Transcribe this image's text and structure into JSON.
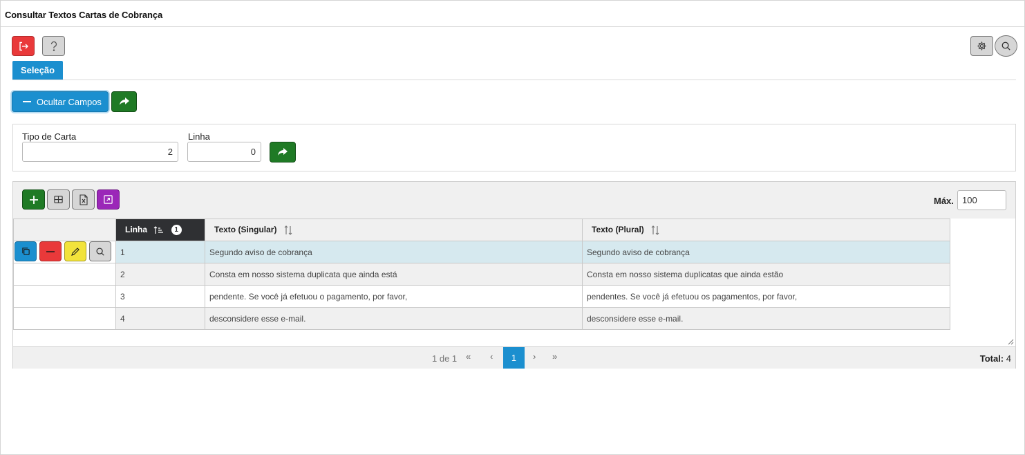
{
  "window": {
    "title": "Consultar Textos Cartas de Cobrança"
  },
  "tabs": [
    {
      "label": "Seleção",
      "active": true
    }
  ],
  "form": {
    "toggle_label": "Ocultar Campos",
    "fields": [
      {
        "label": "Tipo de Carta",
        "value": "2"
      },
      {
        "label": "Linha",
        "value": "0"
      }
    ]
  },
  "grid": {
    "max_label": "Máx.",
    "max_value": "100",
    "columns": [
      {
        "label": "Linha",
        "sort_badge": "1",
        "active": true
      },
      {
        "label": "Texto (Singular)"
      },
      {
        "label": "Texto (Plural)"
      }
    ],
    "rows": [
      {
        "linha": "1",
        "singular": "Segundo aviso de cobrança",
        "plural": "Segundo aviso de cobrança"
      },
      {
        "linha": "2",
        "singular": "Consta em nosso sistema duplicata que ainda está",
        "plural": "Consta em nosso sistema duplicatas que ainda estão"
      },
      {
        "linha": "3",
        "singular": "pendente. Se você já efetuou o pagamento, por favor,",
        "plural": "pendentes. Se você já efetuou os pagamentos, por favor,"
      },
      {
        "linha": "4",
        "singular": "desconsidere esse e-mail.",
        "plural": "desconsidere esse e-mail."
      }
    ],
    "pager": {
      "info": "1 de 1",
      "current_page": "1",
      "first": "«",
      "prev": "‹",
      "next": "›",
      "last": "»",
      "total_label": "Total:",
      "total_value": "4"
    }
  },
  "icons": {
    "exit": "exit-icon",
    "help": "question-icon",
    "settings": "gear-icon",
    "search": "search-icon",
    "forward": "share-forward-icon",
    "add": "plus-icon",
    "grid": "table-icon",
    "excel": "excel-file-icon",
    "expand": "expand-icon",
    "copy": "copy-icon",
    "remove": "minus-icon",
    "edit": "pencil-icon"
  },
  "colors": {
    "primary": "#1b8fcf",
    "danger": "#e9393a",
    "success": "#1f7a25",
    "warning": "#f2e33b",
    "purple": "#9b27b8",
    "selected_row": "#d6e9ef",
    "active_header": "#2f3033"
  }
}
